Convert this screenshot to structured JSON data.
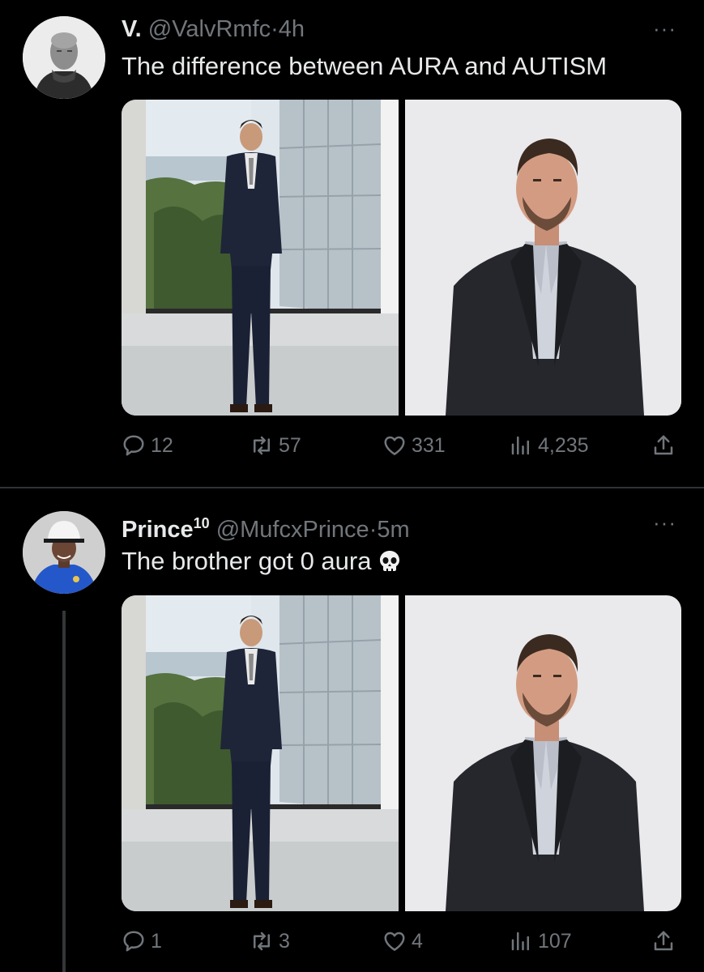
{
  "tweets": [
    {
      "display_name": "V.",
      "display_name_suffix": "",
      "handle": "@ValvRmfc",
      "separator": "·",
      "time": "4h",
      "text": "The difference between AURA and AUTISM",
      "emoji": "",
      "more": "···",
      "stats": {
        "replies": "12",
        "retweets": "57",
        "likes": "331",
        "views": "4,235"
      }
    },
    {
      "display_name": "Prince",
      "display_name_suffix": "10",
      "handle": "@MufcxPrince",
      "separator": "·",
      "time": "5m",
      "text": "The brother got 0 aura",
      "emoji": "skull-emoji",
      "more": "···",
      "stats": {
        "replies": "1",
        "retweets": "3",
        "likes": "4",
        "views": "107"
      }
    }
  ],
  "icons": [
    "ellipsis-icon",
    "reply-icon",
    "retweet-icon",
    "like-icon",
    "views-icon",
    "share-icon",
    "skull-emoji"
  ],
  "colors": {
    "background": "#000000",
    "text": "#e7e9ea",
    "muted": "#71767b",
    "divider": "#2f3336"
  }
}
